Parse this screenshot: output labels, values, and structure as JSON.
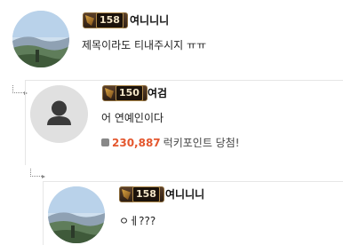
{
  "comments": [
    {
      "level": "158",
      "username": "여니니니",
      "text": "제목이라도 티내주시지 ㅠㅠ",
      "avatar": "landscape-photo"
    },
    {
      "level": "150",
      "username": "여검",
      "text": "어 연예인이다",
      "avatar": "default-user-icon",
      "reward": {
        "amount": "230,887",
        "label": "럭키포인트 당첨!"
      }
    },
    {
      "level": "158",
      "username": "여니니니",
      "text": "ㅇㅔ???",
      "avatar": "landscape-photo"
    }
  ],
  "colors": {
    "accent_orange": "#e4572e",
    "badge_dark": "#2e1f14",
    "placeholder_gray": "#e0e0e0"
  }
}
